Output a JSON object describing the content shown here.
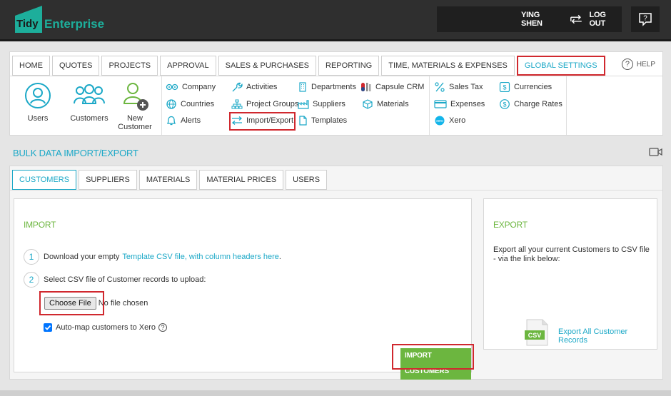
{
  "header": {
    "logo_box": "Tidy",
    "logo_text": "Enterprise",
    "username": "YING SHEN",
    "logout": "LOG OUT",
    "help_glyph": "?"
  },
  "nav": {
    "tabs": [
      "HOME",
      "QUOTES",
      "PROJECTS",
      "APPROVAL",
      "SALES & PURCHASES",
      "REPORTING",
      "TIME, MATERIALS & EXPENSES",
      "GLOBAL SETTINGS"
    ],
    "active_tab": "GLOBAL SETTINGS",
    "help_label": "HELP"
  },
  "settings": {
    "users": "Users",
    "customers": "Customers",
    "new_customer_1": "New",
    "new_customer_2": "Customer",
    "company": "Company",
    "countries": "Countries",
    "alerts": "Alerts",
    "activities": "Activities",
    "project_groups": "Project Groups",
    "import_export": "Import/Export",
    "departments": "Departments",
    "suppliers": "Suppliers",
    "templates": "Templates",
    "capsule_crm": "Capsule CRM",
    "materials": "Materials",
    "sales_tax": "Sales Tax",
    "expenses": "Expenses",
    "xero": "Xero",
    "xero_badge": "xero",
    "currencies": "Currencies",
    "charge_rates": "Charge Rates"
  },
  "page": {
    "title": "BULK DATA IMPORT/EXPORT",
    "subtabs": [
      "CUSTOMERS",
      "SUPPLIERS",
      "MATERIALS",
      "MATERIAL PRICES",
      "USERS"
    ],
    "active_subtab": "CUSTOMERS"
  },
  "import": {
    "title": "IMPORT",
    "step1_num": "1",
    "step1_text": "Download your empty",
    "step1_link": "Template CSV file, with column headers here",
    "step1_end": ".",
    "step2_num": "2",
    "step2_text": "Select CSV file of Customer records to upload:",
    "choose_file": "Choose File",
    "no_file": "No file chosen",
    "automap": "Auto-map customers to Xero",
    "automap_checked": true,
    "button": "IMPORT CUSTOMERS"
  },
  "export": {
    "title": "EXPORT",
    "text": "Export all your current Customers to CSV file - via the link below:",
    "csv_label": "CSV",
    "link": "Export All Customer Records"
  },
  "colors": {
    "teal": "#1ba8c7",
    "green": "#6cb63f",
    "highlight": "#d0282e"
  }
}
